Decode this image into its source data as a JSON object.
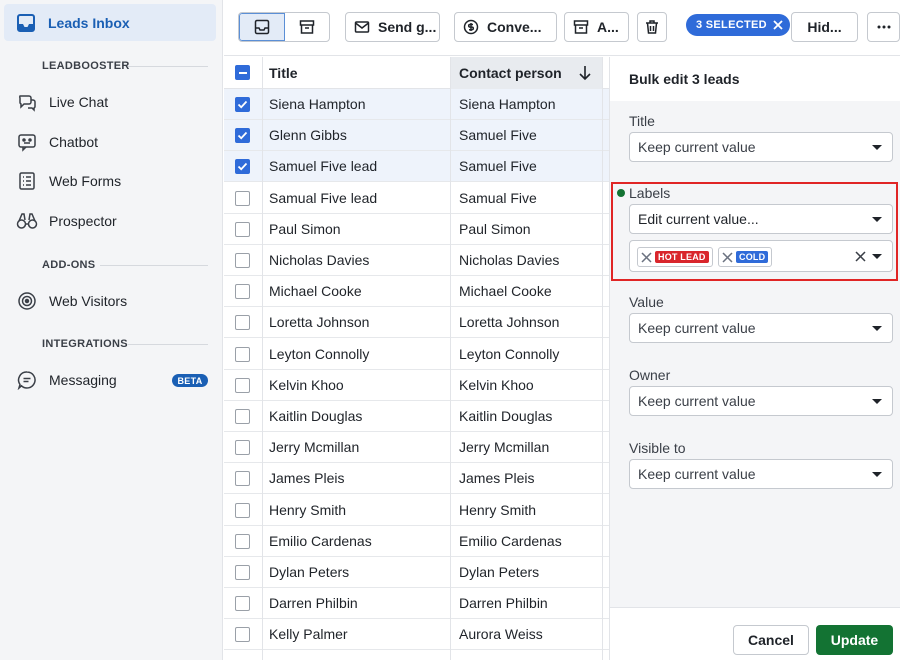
{
  "sidebar": {
    "active": "Leads Inbox",
    "sections": [
      "LEADBOOSTER",
      "ADD-ONS",
      "INTEGRATIONS"
    ],
    "items": [
      "Live Chat",
      "Chatbot",
      "Web Forms",
      "Prospector",
      "Web Visitors",
      "Messaging"
    ],
    "beta": "BETA"
  },
  "toolbar": {
    "send": "Send g...",
    "convert": "Conve...",
    "archive": "A...",
    "selected": "3 SELECTED",
    "hide": "Hid..."
  },
  "table": {
    "col_title": "Title",
    "col_contact": "Contact person",
    "rows": [
      {
        "title": "Siena Hampton",
        "contact": "Siena Hampton",
        "checked": true
      },
      {
        "title": "Glenn Gibbs",
        "contact": "Samuel Five",
        "checked": true
      },
      {
        "title": "Samuel Five lead",
        "contact": "Samuel Five",
        "checked": true
      },
      {
        "title": "Samual Five lead",
        "contact": "Samual Five",
        "checked": false
      },
      {
        "title": "Paul Simon",
        "contact": "Paul Simon",
        "checked": false
      },
      {
        "title": "Nicholas Davies",
        "contact": "Nicholas Davies",
        "checked": false
      },
      {
        "title": "Michael Cooke",
        "contact": "Michael Cooke",
        "checked": false
      },
      {
        "title": "Loretta Johnson",
        "contact": "Loretta Johnson",
        "checked": false
      },
      {
        "title": "Leyton Connolly",
        "contact": "Leyton Connolly",
        "checked": false
      },
      {
        "title": "Kelvin Khoo",
        "contact": "Kelvin Khoo",
        "checked": false
      },
      {
        "title": "Kaitlin Douglas",
        "contact": "Kaitlin Douglas",
        "checked": false
      },
      {
        "title": "Jerry Mcmillan",
        "contact": "Jerry Mcmillan",
        "checked": false
      },
      {
        "title": "James Pleis",
        "contact": "James Pleis",
        "checked": false
      },
      {
        "title": "Henry Smith",
        "contact": "Henry Smith",
        "checked": false
      },
      {
        "title": "Emilio Cardenas",
        "contact": "Emilio Cardenas",
        "checked": false
      },
      {
        "title": "Dylan Peters",
        "contact": "Dylan Peters",
        "checked": false
      },
      {
        "title": "Darren Philbin",
        "contact": "Darren Philbin",
        "checked": false
      },
      {
        "title": "Kelly Palmer",
        "contact": "Aurora Weiss",
        "checked": false
      }
    ]
  },
  "panel": {
    "title": "Bulk edit 3 leads",
    "fields": {
      "title": {
        "label": "Title",
        "value": "Keep current value"
      },
      "labels": {
        "label": "Labels",
        "value": "Edit current value..."
      },
      "value": {
        "label": "Value",
        "value": "Keep current value"
      },
      "owner": {
        "label": "Owner",
        "value": "Keep current value"
      },
      "visible": {
        "label": "Visible to",
        "value": "Keep current value"
      }
    },
    "tags": [
      {
        "text": "HOT LEAD",
        "color": "#d9262c"
      },
      {
        "text": "COLD",
        "color": "#2f6bd9"
      }
    ],
    "cancel": "Cancel",
    "update": "Update"
  }
}
